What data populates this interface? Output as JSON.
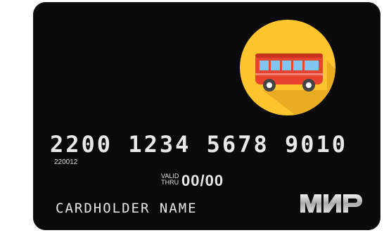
{
  "card": {
    "number": "2200 1234 5678 9010",
    "bin": "220012",
    "valid_label_top": "VALID",
    "valid_label_bottom": "THRU",
    "expiry": "00/00",
    "holder": "CARDHOLDER NAME",
    "brand": "МИР"
  },
  "colors": {
    "card_background": "#0a0a0a",
    "emblem_circle": "#ffc52e",
    "bus_body": "#e8432f",
    "bus_windows": "#7fc7f0",
    "text": "#e8e8e8"
  },
  "icons": {
    "emblem": "bus-icon"
  }
}
